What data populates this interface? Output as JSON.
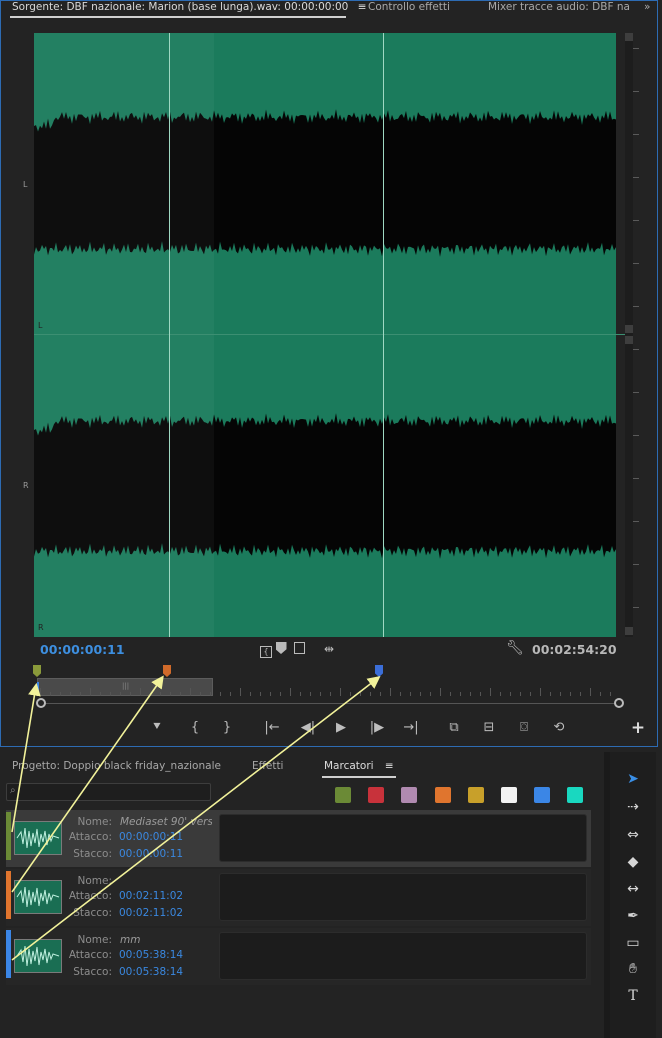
{
  "tabs": {
    "source": "Sorgente: DBF nazionale: Marion (base lunga).wav: 00:00:00:00",
    "source_menu": "≡",
    "effects": "Controllo effetti",
    "mixer": "Mixer tracce audio: DBF na"
  },
  "channels": {
    "left": "L",
    "right": "R"
  },
  "timecodes": {
    "current": "00:00:00:11",
    "duration": "00:02:54:20"
  },
  "transport": [
    "add-marker",
    "mark-in",
    "mark-out",
    "go-to-in",
    "step-back",
    "play",
    "step-forward",
    "go-to-out",
    "insert",
    "overwrite",
    "export-frame",
    "replace"
  ],
  "bottom_tabs": {
    "project": "Progetto: Doppio black friday_nazionale",
    "effects": "Effetti",
    "markers": "Marcatori",
    "markers_menu": "≡"
  },
  "swatches": [
    "#6b8a36",
    "#c8323b",
    "#b08ab0",
    "#e0752e",
    "#c8a02a",
    "#f2f2f2",
    "#3b86e6",
    "#19d8c0"
  ],
  "markers": [
    {
      "color": "#6b8a36",
      "name_label": "Nome:",
      "name": "Mediaset 90' vers...",
      "in_label": "Attacco:",
      "in": "00:00:00:11",
      "out_label": "Stacco:",
      "out": "00:00:00:11"
    },
    {
      "color": "#e0752e",
      "name_label": "Nome:",
      "name": "",
      "in_label": "Attacco:",
      "in": "00:02:11:02",
      "out_label": "Stacco:",
      "out": "00:02:11:02"
    },
    {
      "color": "#3b86e6",
      "name_label": "Nome:",
      "name": "mm",
      "in_label": "Attacco:",
      "in": "00:05:38:14",
      "out_label": "Stacco:",
      "out": "00:05:38:14"
    }
  ],
  "tools": [
    "selection",
    "track-select",
    "ripple-edit",
    "razor",
    "slip",
    "pen",
    "rectangle",
    "hand",
    "type"
  ],
  "plus_label": "+",
  "tab_overflow": "»"
}
